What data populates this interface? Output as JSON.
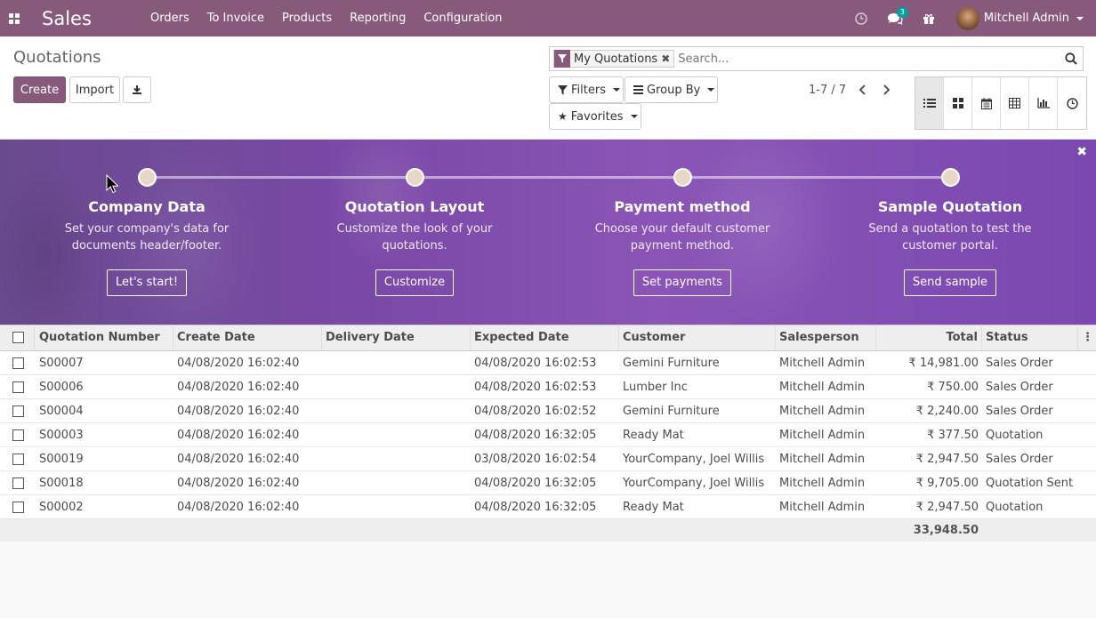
{
  "app": {
    "title": "Sales"
  },
  "menu": {
    "items": [
      "Orders",
      "To Invoice",
      "Products",
      "Reporting",
      "Configuration"
    ]
  },
  "topbar": {
    "chat_badge": "3",
    "user_name": "Mitchell Admin"
  },
  "breadcrumb": {
    "title": "Quotations"
  },
  "buttons": {
    "create": "Create",
    "import": "Import"
  },
  "search": {
    "facet": "My Quotations",
    "placeholder": "Search..."
  },
  "filters": {
    "filters": "Filters",
    "group_by": "Group By",
    "favorites": "Favorites"
  },
  "pager": {
    "value": "1-7 / 7"
  },
  "views": [
    "list-view",
    "kanban-view",
    "calendar-view",
    "pivot-view",
    "graph-view",
    "activity-view"
  ],
  "onboarding": {
    "steps": [
      {
        "title": "Company Data",
        "desc1": "Set your company's data for",
        "desc2": "documents header/footer.",
        "button": "Let's start!"
      },
      {
        "title": "Quotation Layout",
        "desc1": "Customize the look of your",
        "desc2": "quotations.",
        "button": "Customize"
      },
      {
        "title": "Payment method",
        "desc1": "Choose your default customer",
        "desc2": "payment method.",
        "button": "Set payments"
      },
      {
        "title": "Sample Quotation",
        "desc1": "Send a quotation to test the",
        "desc2": "customer portal.",
        "button": "Send sample"
      }
    ]
  },
  "table": {
    "columns": [
      "Quotation Number",
      "Create Date",
      "Delivery Date",
      "Expected Date",
      "Customer",
      "Salesperson",
      "Total",
      "Status"
    ],
    "rows": [
      {
        "number": "S00007",
        "create": "04/08/2020 16:02:40",
        "delivery": "",
        "expected": "04/08/2020 16:02:53",
        "customer": "Gemini Furniture",
        "salesperson": "Mitchell Admin",
        "total": "₹ 14,981.00",
        "status": "Sales Order"
      },
      {
        "number": "S00006",
        "create": "04/08/2020 16:02:40",
        "delivery": "",
        "expected": "04/08/2020 16:02:53",
        "customer": "Lumber Inc",
        "salesperson": "Mitchell Admin",
        "total": "₹ 750.00",
        "status": "Sales Order"
      },
      {
        "number": "S00004",
        "create": "04/08/2020 16:02:40",
        "delivery": "",
        "expected": "04/08/2020 16:02:52",
        "customer": "Gemini Furniture",
        "salesperson": "Mitchell Admin",
        "total": "₹ 2,240.00",
        "status": "Sales Order"
      },
      {
        "number": "S00003",
        "create": "04/08/2020 16:02:40",
        "delivery": "",
        "expected": "04/08/2020 16:32:05",
        "customer": "Ready Mat",
        "salesperson": "Mitchell Admin",
        "total": "₹ 377.50",
        "status": "Quotation"
      },
      {
        "number": "S00019",
        "create": "04/08/2020 16:02:40",
        "delivery": "",
        "expected": "03/08/2020 16:02:54",
        "customer": "YourCompany, Joel Willis",
        "salesperson": "Mitchell Admin",
        "total": "₹ 2,947.50",
        "status": "Sales Order"
      },
      {
        "number": "S00018",
        "create": "04/08/2020 16:02:40",
        "delivery": "",
        "expected": "04/08/2020 16:32:05",
        "customer": "YourCompany, Joel Willis",
        "salesperson": "Mitchell Admin",
        "total": "₹ 9,705.00",
        "status": "Quotation Sent"
      },
      {
        "number": "S00002",
        "create": "04/08/2020 16:02:40",
        "delivery": "",
        "expected": "04/08/2020 16:32:05",
        "customer": "Ready Mat",
        "salesperson": "Mitchell Admin",
        "total": "₹ 2,947.50",
        "status": "Quotation"
      }
    ],
    "footer_total": "33,948.50"
  },
  "colors": {
    "brand": "#875a7b",
    "banner": "#7b49a8"
  }
}
